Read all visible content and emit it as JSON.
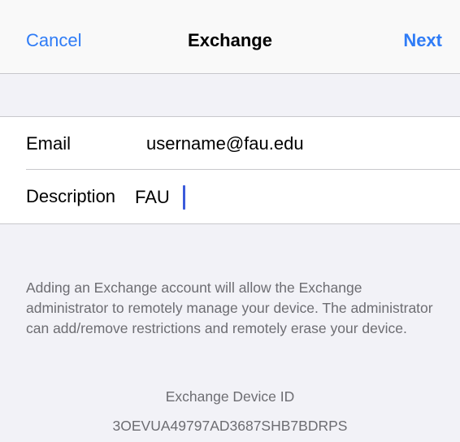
{
  "navbar": {
    "cancel_label": "Cancel",
    "title": "Exchange",
    "next_label": "Next"
  },
  "form": {
    "email": {
      "label": "Email",
      "value": "username@fau.edu"
    },
    "description": {
      "label": "Description",
      "value": "FAU"
    }
  },
  "footer": {
    "note": "Adding an Exchange account will allow the Exchange administrator to remotely manage your device. The administrator can add/remove restrictions and remotely erase your device.",
    "device_id_label": "Exchange Device ID",
    "device_id_value": "3OEVUA49797AD3687SHB7BDRPS"
  },
  "colors": {
    "accent": "#2f7cf6",
    "background": "#f2f2f7",
    "secondary_text": "#6d6d72",
    "caret": "#3b5bdb"
  }
}
